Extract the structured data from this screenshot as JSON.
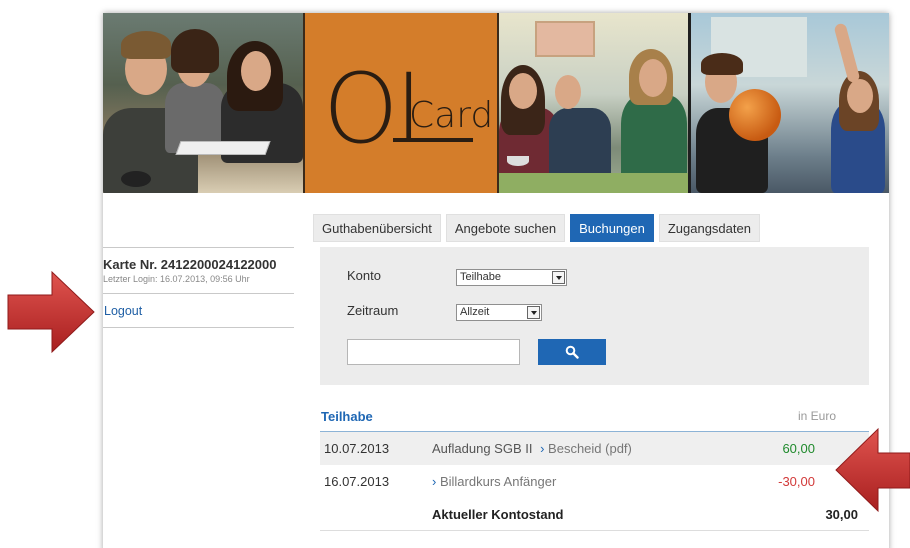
{
  "banner": {
    "logo_big": "OL",
    "logo_small": "Card"
  },
  "sidebar": {
    "card_number": "Karte Nr. 2412200024122000",
    "last_login": "Letzter Login: 16.07.2013, 09:56 Uhr",
    "logout_label": "Logout"
  },
  "tabs": [
    {
      "label": "Guthabenübersicht",
      "active": false
    },
    {
      "label": "Angebote suchen",
      "active": false
    },
    {
      "label": "Buchungen",
      "active": true
    },
    {
      "label": "Zugangsdaten",
      "active": false
    }
  ],
  "filter": {
    "konto_label": "Konto",
    "konto_value": "Teilhabe",
    "zeitraum_label": "Zeitraum",
    "zeitraum_value": "Allzeit",
    "search_value": "",
    "search_icon": "search-icon"
  },
  "table": {
    "title": "Teilhabe",
    "unit": "in  Euro",
    "rows": [
      {
        "date": "10.07.2013",
        "desc": "Aufladung SGB II",
        "link_prefix": "›",
        "link_text": "Bescheid (pdf)",
        "amount": "60,00"
      },
      {
        "date": "16.07.2013",
        "desc": "",
        "link_prefix": "›",
        "link_text": "Billardkurs Anfänger",
        "amount": "-30,00"
      }
    ],
    "total_label": "Aktueller Kontostand",
    "total_amount": "30,00"
  },
  "colors": {
    "accent": "#1f67b4",
    "positive": "#1f8a2c",
    "negative": "#d23a3a",
    "annotation_arrow": "#c8302e"
  }
}
